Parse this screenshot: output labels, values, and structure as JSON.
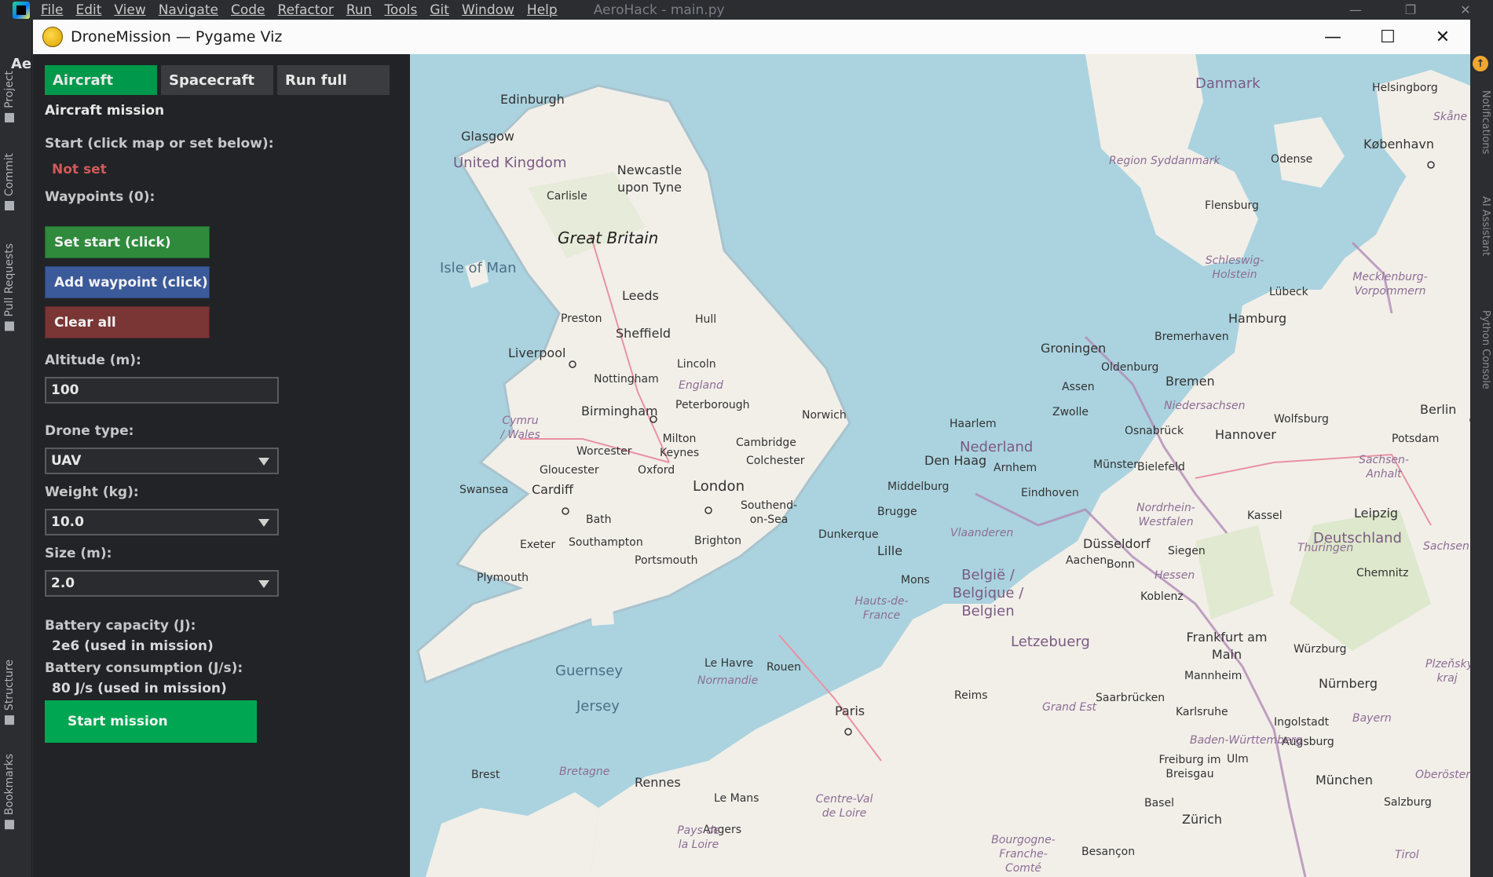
{
  "ide": {
    "menu": [
      "File",
      "Edit",
      "View",
      "Navigate",
      "Code",
      "Refactor",
      "Run",
      "Tools",
      "Git",
      "Window",
      "Help"
    ],
    "title": "AeroHack - main.py",
    "project_abbrev": "Ae",
    "left_tabs": [
      "Project",
      "Commit",
      "Pull Requests",
      "Structure",
      "Bookmarks"
    ],
    "right_tabs": [
      "Notifications",
      "AI Assistant",
      "Python Console"
    ]
  },
  "window": {
    "title": "DroneMission — Pygame Viz"
  },
  "panel": {
    "tabs": [
      "Aircraft",
      "Spacecraft",
      "Run full"
    ],
    "heading": "Aircraft mission",
    "start_label": "Start (click map or set below):",
    "start_value": "Not set",
    "waypoints_label": "Waypoints (0):",
    "set_start_button": "Set start (click)",
    "add_waypoint_button": "Add waypoint (click)",
    "clear_all_button": "Clear all",
    "altitude_label": "Altitude (m):",
    "altitude_value": "100",
    "drone_type_label": "Drone type:",
    "drone_type_value": "UAV",
    "weight_label": "Weight (kg):",
    "weight_value": "10.0",
    "size_label": "Size (m):",
    "size_value": "2.0",
    "battery_capacity_label": "Battery capacity (J):",
    "battery_capacity_value": "2e6 (used in mission)",
    "battery_consumption_label": "Battery consumption (J/s):",
    "battery_consumption_value": "80 J/s (used in mission)",
    "start_mission_button": "Start mission"
  },
  "colors": {
    "tab_active": "#00984a",
    "tab_inactive": "#3b3c3f",
    "start_button": "#2f8a3c",
    "waypoint_button": "#3b5a9a",
    "clear_button": "#7a3535",
    "mission_button": "#00a651",
    "not_set": "#d05a5a",
    "sea": "#aad3df",
    "land": "#f2efe9"
  },
  "map_labels": {
    "cities": [
      "Edinburgh",
      "Glasgow",
      "Newcastle upon Tyne",
      "Carlisle",
      "Leeds",
      "Preston",
      "Hull",
      "Sheffield",
      "Liverpool",
      "Lincoln",
      "Nottingham",
      "Peterborough",
      "Norwich",
      "Birmingham",
      "Milton Keynes",
      "Cambridge",
      "Colchester",
      "Worcester",
      "Gloucester",
      "Oxford",
      "London",
      "Swansea",
      "Cardiff",
      "Bath",
      "Southend-on-Sea",
      "Exeter",
      "Southampton",
      "Brighton",
      "Portsmouth",
      "Plymouth",
      "Dunkerque",
      "Lille",
      "Mons",
      "Brugge",
      "Middelburg",
      "Den Haag",
      "Haarlem",
      "Arnhem",
      "Eindhoven",
      "Groningen",
      "Oldenburg",
      "Assen",
      "Zwolle",
      "Bremen",
      "Bremerhaven",
      "Osnabrück",
      "Münster",
      "Bielefeld",
      "Hannover",
      "Wolfsburg",
      "Berlin",
      "Potsdam",
      "Hamburg",
      "Lübeck",
      "Flensburg",
      "Odense",
      "København",
      "Helsingborg",
      "Kassel",
      "Leipzig",
      "Düsseldorf",
      "Aachen",
      "Bonn",
      "Siegen",
      "Koblenz",
      "Chemnitz",
      "Frankfurt am Main",
      "Würzburg",
      "Mannheim",
      "Nürnberg",
      "Saarbrücken",
      "Karlsruhe",
      "Ingolstadt",
      "Augsburg",
      "Ulm",
      "München",
      "Freiburg im Breisgau",
      "Basel",
      "Zürich",
      "Salzburg",
      "Reims",
      "Paris",
      "Rouen",
      "Le Havre",
      "Rennes",
      "Brest",
      "Le Mans",
      "Angers",
      "Besançon"
    ],
    "countries": [
      "United Kingdom",
      "Great Britain",
      "England",
      "Nederland",
      "België / Belgique / Belgien",
      "Deutschland",
      "Letzebuerg",
      "Danmark"
    ],
    "regions": [
      "Cymru / Wales",
      "Region Syddanmark",
      "Schleswig-Holstein",
      "Mecklenburg-Vorpommern",
      "Niedersachsen",
      "Sachsen-Anhalt",
      "Nordrhein-Westfalen",
      "Vlaanderen",
      "Hauts-de-France",
      "Hessen",
      "Thüringen",
      "Sachsen",
      "Grand Est",
      "Baden-Württemberg",
      "Bayern",
      "Normandie",
      "Bretagne",
      "Centre-Val de Loire",
      "Pays de la Loire",
      "Bourgogne-Franche-Comté",
      "Plzeňský kraj",
      "Oberösterreich",
      "Skåne län",
      "Tirol"
    ],
    "isles": [
      "Isle of Man",
      "Guernsey",
      "Jersey"
    ]
  }
}
